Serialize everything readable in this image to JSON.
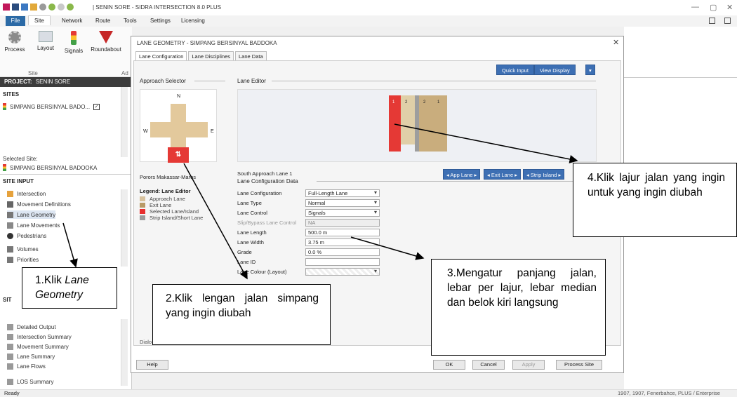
{
  "app": {
    "title": "| SENIN SORE - SIDRA INTERSECTION 8.0 PLUS",
    "window_controls": [
      "—",
      "▢",
      "✕"
    ],
    "status_left": "Ready",
    "status_right": "1907, 1907, Fenerbahce, PLUS / Enterprise"
  },
  "menu": {
    "items": [
      "File",
      "Site",
      "Network",
      "Route",
      "Tools",
      "Settings",
      "Licensing"
    ]
  },
  "ribbon": {
    "buttons": [
      "Process",
      "Layout",
      "Signals",
      "Roundabout"
    ],
    "group_label": "Site",
    "group_label_2": "Ad"
  },
  "left_panel": {
    "project_label": "PROJECT:",
    "project_name": "SENIN SORE",
    "sites_heading": "SITES",
    "site_name": "SIMPANG BERSINYAL BADO...",
    "selected_site_label": "Selected Site:",
    "selected_site_name": "SIMPANG BERSINYAL BADOOKA",
    "site_input_heading": "SITE INPUT",
    "site_input_items": [
      "Intersection",
      "Movement Definitions",
      "Lane Geometry",
      "Lane Movements",
      "Pedestrians",
      "Volumes",
      "Priorities"
    ],
    "sit_heading": "SIT",
    "output_items": [
      "Detailed Output",
      "Intersection Summary",
      "Movement Summary",
      "Lane Summary",
      "Lane Flows",
      "LOS Summary"
    ]
  },
  "dialog": {
    "title": "LANE GEOMETRY - SIMPANG BERSINYAL BADDOKA",
    "close": "✕",
    "tabs": [
      "Lane Configuration",
      "Lane Disciplines",
      "Lane Data"
    ],
    "quick_input": "Quick Input",
    "view_display": "View Display",
    "approach_selector_label": "Approach Selector",
    "compass": {
      "n": "N",
      "w": "W",
      "e": "E"
    },
    "approach_name": "Porors Makassar-Maros",
    "lane_editor_label": "Lane Editor",
    "lane_numbers": [
      "1",
      "2",
      "2",
      "1"
    ],
    "lane_caption": "South Approach Lane 1",
    "lane_nav": [
      "◂ App Lane ▸",
      "◂ Exit Lane ▸",
      "◂ Strip Island ▸"
    ],
    "legend_title": "Legend: Lane Editor",
    "legend": [
      {
        "label": "Approach Lane",
        "color": "#d8c29e"
      },
      {
        "label": "Exit Lane",
        "color": "#b89a66"
      },
      {
        "label": "Selected Lane/Island",
        "color": "#e83030"
      },
      {
        "label": "Strip Island/Short Lane",
        "color": "#9c9c9c"
      }
    ],
    "lane_config_data_label": "Lane Configuration Data",
    "fields": [
      {
        "label": "Lane Configuration",
        "value": "Full-Length Lane",
        "dropdown": true
      },
      {
        "label": "Lane Type",
        "value": "Normal",
        "dropdown": true
      },
      {
        "label": "Lane Control",
        "value": "Signals",
        "dropdown": true
      },
      {
        "label": "Slip/Bypass Lane Control",
        "value": "NA",
        "dropdown": false
      },
      {
        "label": "Lane Length",
        "value": "500.0 m",
        "dropdown": false
      },
      {
        "label": "Lane Width",
        "value": "3.75 m",
        "dropdown": false
      },
      {
        "label": "Grade",
        "value": "0.0 %",
        "dropdown": false
      },
      {
        "label": "Lane ID",
        "value": "",
        "dropdown": false
      },
      {
        "label": "Lane Colour (Layout)",
        "value": "",
        "dropdown": true
      }
    ],
    "dialog_link": "Dialo",
    "buttons": {
      "help": "Help",
      "ok": "OK",
      "cancel": "Cancel",
      "apply": "Apply",
      "process_site": "Process Site"
    }
  },
  "callouts": {
    "c1_prefix": "1.Klik ",
    "c1_italic": "Lane Geometry",
    "c2": "2.Klik lengan jalan simpang yang ingin diubah",
    "c3": "3.Mengatur panjang jalan, lebar per lajur, lebar median dan belok kiri langsung",
    "c4": "4.Klik lajur jalan yang ingin untuk yang ingin diubah"
  }
}
